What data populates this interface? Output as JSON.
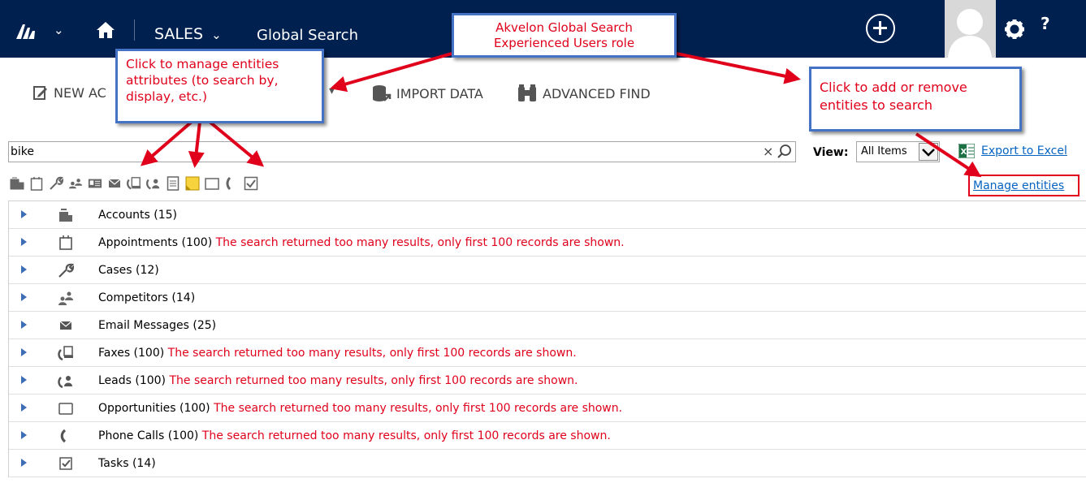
{
  "topbar": {
    "logo_icon": "dynamics-logo-icon",
    "module": "SALES",
    "module_chevron": "⌄",
    "title": "Global Search",
    "help": "?"
  },
  "commands": {
    "new_label": "NEW AC",
    "import_label": "IMPORT DATA",
    "advanced_find_label": "ADVANCED FIND"
  },
  "search": {
    "value": "bike",
    "clear": "×",
    "view_label": "View:",
    "view_value": "All Items",
    "export_label": "Export to Excel",
    "manage_label": "Manage entities"
  },
  "results": [
    {
      "icon": "account-icon",
      "label": "Accounts (15)",
      "warning": ""
    },
    {
      "icon": "appointment-icon",
      "label": "Appointments (100)",
      "warning": "The search returned too many results, only first 100 records are shown."
    },
    {
      "icon": "case-wrench-icon",
      "label": "Cases (12)",
      "warning": ""
    },
    {
      "icon": "competitor-icon",
      "label": "Competitors (14)",
      "warning": ""
    },
    {
      "icon": "email-icon",
      "label": "Email Messages (25)",
      "warning": ""
    },
    {
      "icon": "fax-icon",
      "label": "Faxes (100)",
      "warning": "The search returned too many results, only first 100 records are shown."
    },
    {
      "icon": "lead-icon",
      "label": "Leads (100)",
      "warning": "The search returned too many results, only first 100 records are shown."
    },
    {
      "icon": "opportunity-icon",
      "label": "Opportunities (100)",
      "warning": "The search returned too many results, only first 100 records are shown."
    },
    {
      "icon": "phone-call-icon",
      "label": "Phone Calls (100)",
      "warning": "The search returned too many results, only first 100 records are shown."
    },
    {
      "icon": "task-icon",
      "label": "Tasks (14)",
      "warning": ""
    }
  ],
  "callouts": {
    "role": "Akvelon Global Search Experienced Users role",
    "attributes": "Click to manage entities attributes (to search by, display, etc.)",
    "entities": "Click to add or remove entities to search"
  },
  "colors": {
    "nav": "#002050",
    "callout_border": "#4472c4",
    "callout_text": "#e0001b",
    "link": "#0563c1"
  }
}
